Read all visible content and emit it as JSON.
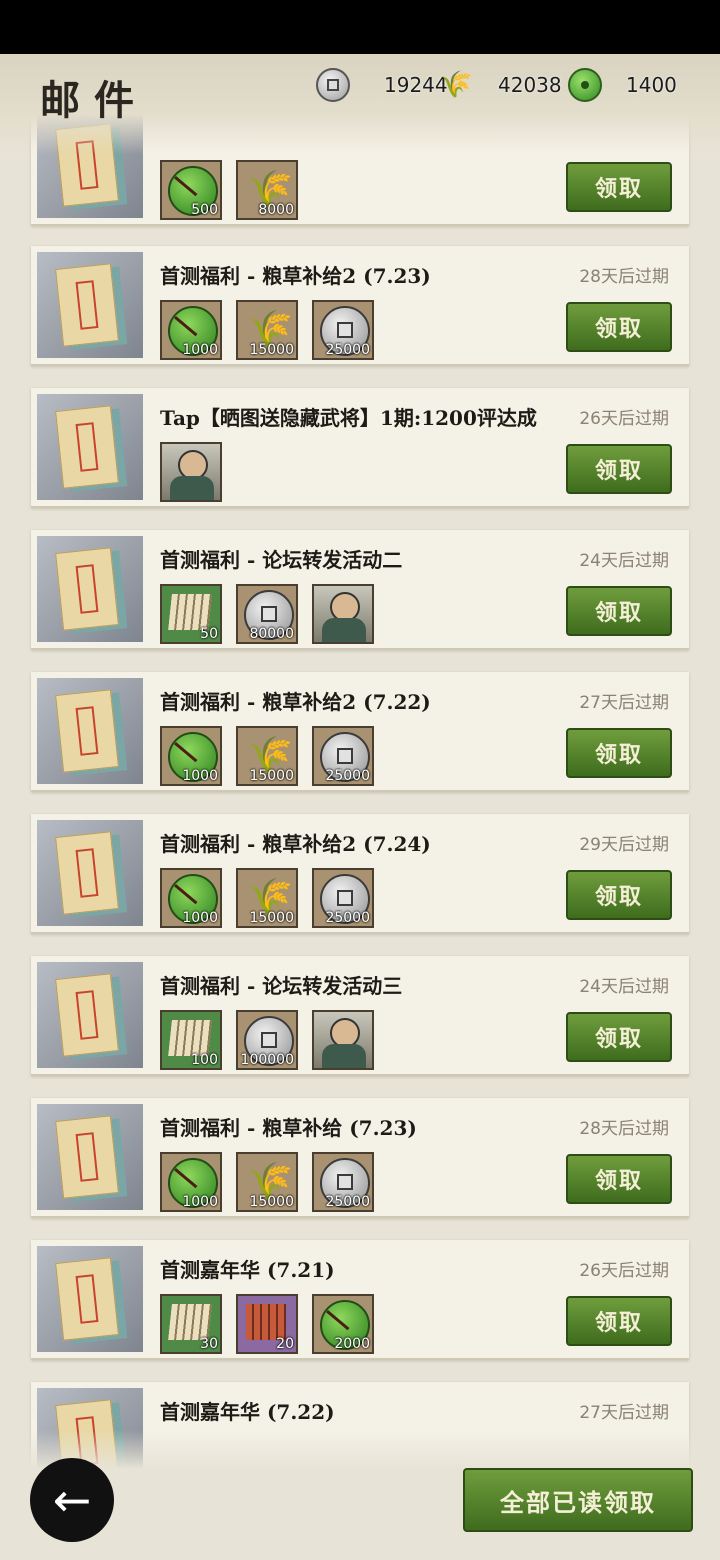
{
  "header": {
    "title": "邮件",
    "currencies": [
      {
        "icon": "coin-icon",
        "value": "19244"
      },
      {
        "icon": "grain-icon",
        "value": "42038"
      },
      {
        "icon": "jade-icon",
        "value": "1400"
      }
    ]
  },
  "mails": [
    {
      "title": "",
      "expiry": "",
      "claim_label": "领取",
      "items": [
        {
          "type": "jade",
          "qty": "500"
        },
        {
          "type": "grain",
          "qty": "8000"
        }
      ]
    },
    {
      "title": "首测福利 - 粮草补给2 (7.23)",
      "expiry": "28天后过期",
      "claim_label": "领取",
      "items": [
        {
          "type": "jade",
          "qty": "1000"
        },
        {
          "type": "grain",
          "qty": "15000"
        },
        {
          "type": "coin",
          "qty": "25000"
        }
      ]
    },
    {
      "title": "Tap【晒图送隐藏武将】1期:1200评达成",
      "expiry": "26天后过期",
      "claim_label": "领取",
      "items": [
        {
          "type": "hero",
          "qty": ""
        }
      ]
    },
    {
      "title": "首测福利 - 论坛转发活动二",
      "expiry": "24天后过期",
      "claim_label": "领取",
      "items": [
        {
          "type": "scroll",
          "qty": "50"
        },
        {
          "type": "coin",
          "qty": "80000"
        },
        {
          "type": "hero",
          "qty": ""
        }
      ]
    },
    {
      "title": "首测福利 - 粮草补给2 (7.22)",
      "expiry": "27天后过期",
      "claim_label": "领取",
      "items": [
        {
          "type": "jade",
          "qty": "1000"
        },
        {
          "type": "grain",
          "qty": "15000"
        },
        {
          "type": "coin",
          "qty": "25000"
        }
      ]
    },
    {
      "title": "首测福利 - 粮草补给2 (7.24)",
      "expiry": "29天后过期",
      "claim_label": "领取",
      "items": [
        {
          "type": "jade",
          "qty": "1000"
        },
        {
          "type": "grain",
          "qty": "15000"
        },
        {
          "type": "coin",
          "qty": "25000"
        }
      ]
    },
    {
      "title": "首测福利 - 论坛转发活动三",
      "expiry": "24天后过期",
      "claim_label": "领取",
      "items": [
        {
          "type": "scroll",
          "qty": "100"
        },
        {
          "type": "coin",
          "qty": "100000"
        },
        {
          "type": "hero",
          "qty": ""
        }
      ]
    },
    {
      "title": "首测福利 - 粮草补给 (7.23)",
      "expiry": "28天后过期",
      "claim_label": "领取",
      "items": [
        {
          "type": "jade",
          "qty": "1000"
        },
        {
          "type": "grain",
          "qty": "15000"
        },
        {
          "type": "coin",
          "qty": "25000"
        }
      ]
    },
    {
      "title": "首测嘉年华 (7.21)",
      "expiry": "26天后过期",
      "claim_label": "领取",
      "items": [
        {
          "type": "scroll",
          "qty": "30"
        },
        {
          "type": "scroll-purple",
          "qty": "20"
        },
        {
          "type": "jade",
          "qty": "2000"
        }
      ]
    },
    {
      "title": "首测嘉年华 (7.22)",
      "expiry": "27天后过期",
      "claim_label": "",
      "items": []
    }
  ],
  "footer": {
    "back_icon": "back-arrow-icon",
    "claim_all_label": "全部已读领取"
  }
}
